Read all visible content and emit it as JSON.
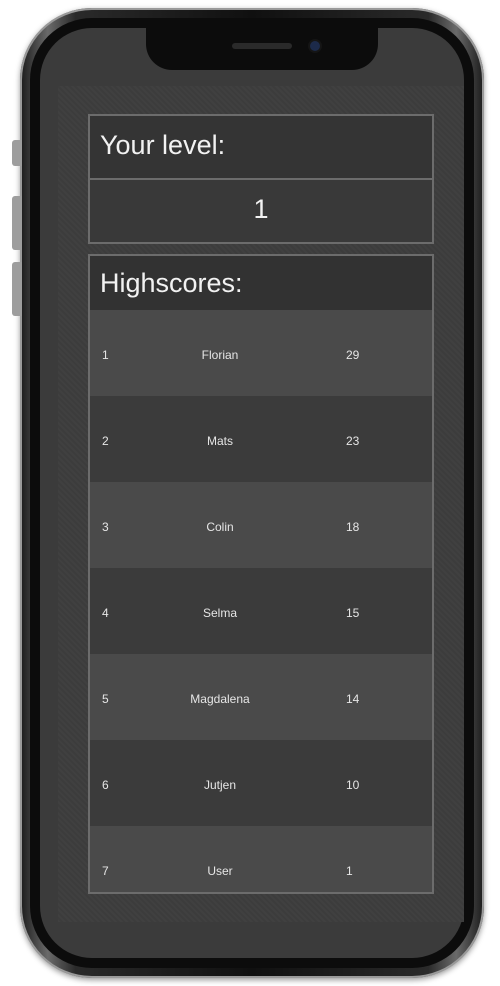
{
  "level_panel": {
    "title": "Your level:",
    "value": "1"
  },
  "highscores": {
    "title": "Highscores:",
    "rows": [
      {
        "rank": "1",
        "name": "Florian",
        "score": "29"
      },
      {
        "rank": "2",
        "name": "Mats",
        "score": "23"
      },
      {
        "rank": "3",
        "name": "Colin",
        "score": "18"
      },
      {
        "rank": "4",
        "name": "Selma",
        "score": "15"
      },
      {
        "rank": "5",
        "name": "Magdalena",
        "score": "14"
      },
      {
        "rank": "6",
        "name": "Jutjen",
        "score": "10"
      },
      {
        "rank": "7",
        "name": "User",
        "score": "1"
      }
    ]
  },
  "colors": {
    "screen_background": "#3d3d3d",
    "panel_border": "#6c6c6c",
    "text": "#f2f2f2"
  }
}
